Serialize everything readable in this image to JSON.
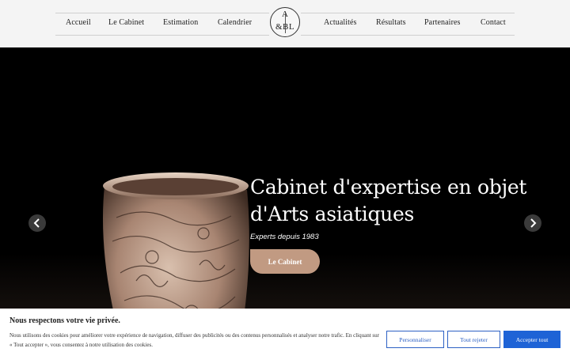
{
  "nav": {
    "items": [
      {
        "label": "Accueil"
      },
      {
        "label": "Le Cabinet"
      },
      {
        "label": "Estimation"
      },
      {
        "label": "Calendrier"
      },
      {
        "label": "Actualités"
      },
      {
        "label": "Résultats"
      },
      {
        "label": "Partenaires"
      },
      {
        "label": "Contact"
      }
    ],
    "logo": {
      "line1": "A",
      "line2": "&BL",
      "letter_b": "B"
    }
  },
  "hero": {
    "title": "Cabinet d'expertise en objet d'Arts asiatiques",
    "subtitle": "Experts depuis 1983",
    "button": "Le Cabinet",
    "button_color": "#c19a82",
    "prev_icon": "chevron-left-icon",
    "next_icon": "chevron-right-icon"
  },
  "cookie": {
    "title": "Nous respectons votre vie privée.",
    "text": "Nous utilisons des cookies pour améliorer votre expérience de navigation, diffuser des publicités ou des contenus personnalisés et analyser notre trafic. En cliquant sur « Tout accepter », vous consentez à notre utilisation des cookies.",
    "customize": "Personnaliser",
    "reject": "Tout rejeter",
    "accept": "Accepter tout",
    "accent": "#1e63d6"
  }
}
